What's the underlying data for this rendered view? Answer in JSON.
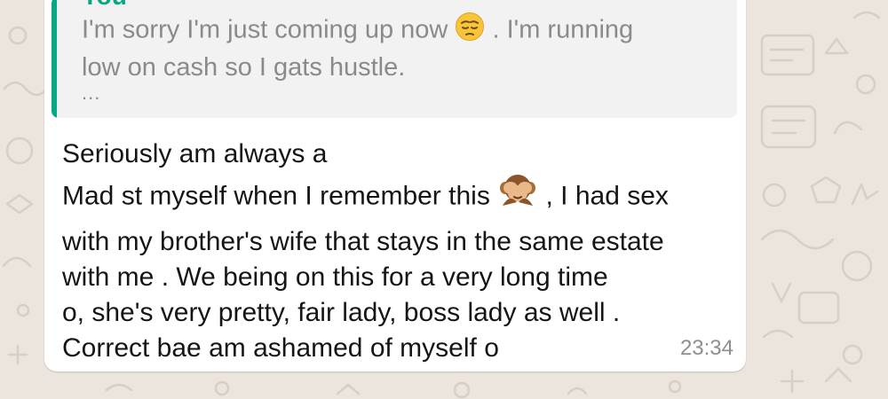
{
  "chat": {
    "quoted": {
      "author": "You",
      "text_before_emoji": "I'm sorry I'm just coming up now ",
      "emoji": "pensive-face-emoji",
      "text_after_emoji": ". I'm running",
      "line2": "low on cash so I gats hustle.",
      "ellipsis": "..."
    },
    "message": {
      "line1": "Seriously  am always a",
      "line2_before_emoji": "Mad st myself when I remember this ",
      "line2_emoji": "see-no-evil-monkey-emoji",
      "line2_after_emoji": ", I had sex",
      "line3": "with my brother's wife that stays in the same estate",
      "line4": "with me .  We being on this for a very long time",
      "line5": "o, she's very pretty,  fair lady, boss lady as well .",
      "line6": "Correct bae am ashamed of myself o"
    },
    "timestamp": "23:34"
  },
  "colors": {
    "background": "#ece5dd",
    "bubble": "#ffffff",
    "quote_background": "#f2f2f2",
    "accent": "#06a884"
  }
}
